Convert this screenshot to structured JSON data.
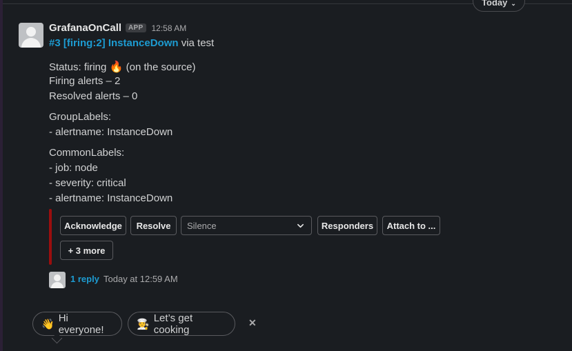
{
  "date_divider": {
    "label": "Today"
  },
  "message": {
    "sender": "GrafanaOnCall",
    "badge": "APP",
    "time": "12:58 AM",
    "title_link": "#3 [firing:2] InstanceDown",
    "title_suffix": " via test",
    "status_prefix": "Status: firing ",
    "status_icon": "fire-icon",
    "status_suffix": " (on the source)",
    "firing_alerts": "Firing alerts – 2",
    "resolved_alerts": "Resolved alerts – 0",
    "group_labels_heading": "GroupLabels:",
    "group_labels": [
      "- alertname: InstanceDown"
    ],
    "common_labels_heading": "CommonLabels:",
    "common_labels": [
      "- job: node",
      "- severity: critical",
      "- alertname: InstanceDown"
    ],
    "accent_color": "#9b0e0e"
  },
  "actions": {
    "acknowledge": "Acknowledge",
    "resolve": "Resolve",
    "silence_select": "Silence",
    "responders": "Responders",
    "attach": "Attach to ...",
    "more": "+ 3 more"
  },
  "thread": {
    "reply_count": "1 reply",
    "last_reply_time": "Today at 12:59 AM"
  },
  "suggestions": [
    {
      "emoji": "👋",
      "label": "Hi everyone!"
    },
    {
      "emoji": "🧑‍🍳",
      "label": "Let’s get cooking"
    }
  ]
}
